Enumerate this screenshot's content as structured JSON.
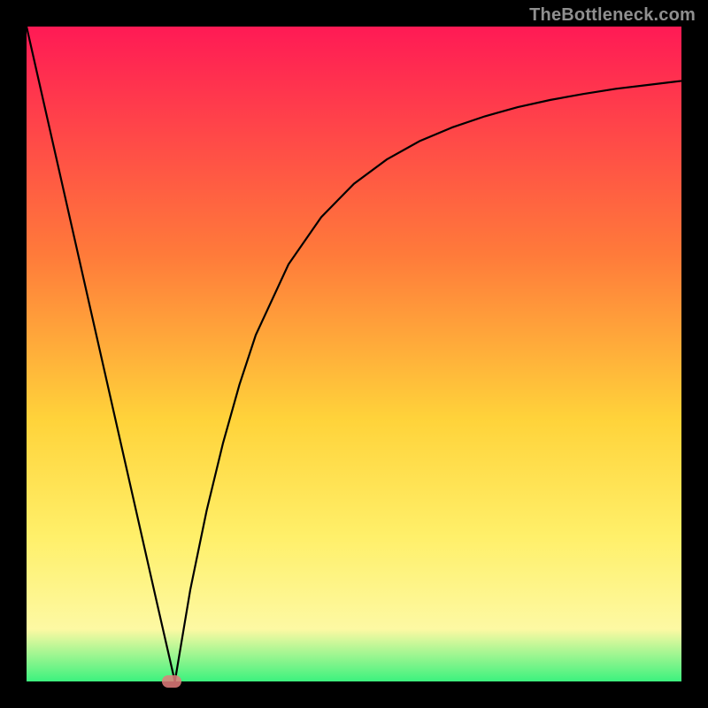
{
  "watermark": "TheBottleneck.com",
  "gradient": {
    "top": "#ff1a55",
    "mid1": "#ff7b3a",
    "mid2": "#ffd33a",
    "mid3": "#fff06a",
    "mid4": "#fdf9a3",
    "bottom": "#3cf27e"
  },
  "chart_data": {
    "type": "line",
    "title": "",
    "xlabel": "",
    "ylabel": "",
    "xlim": [
      0,
      100
    ],
    "ylim": [
      0,
      100
    ],
    "series": [
      {
        "name": "bottleneck-curve",
        "x": [
          0,
          5,
          10,
          15,
          20,
          22.65,
          25,
          27.5,
          30,
          32.5,
          35,
          40,
          45,
          50,
          55,
          60,
          65,
          70,
          75,
          80,
          85,
          90,
          95,
          100
        ],
        "y": [
          100,
          77.9,
          55.8,
          33.7,
          11.6,
          0,
          14.0,
          26.1,
          36.4,
          45.3,
          52.9,
          63.7,
          70.9,
          76.0,
          79.7,
          82.5,
          84.6,
          86.3,
          87.7,
          88.8,
          89.7,
          90.5,
          91.1,
          91.7
        ]
      }
    ],
    "marker": {
      "x": 22.1,
      "y": 0,
      "color": "#e27d7b"
    },
    "background_gradient_stops": [
      {
        "offset": 0.0,
        "color": "#ff1a55"
      },
      {
        "offset": 0.35,
        "color": "#ff7b3a"
      },
      {
        "offset": 0.6,
        "color": "#ffd33a"
      },
      {
        "offset": 0.78,
        "color": "#fff06a"
      },
      {
        "offset": 0.92,
        "color": "#fdf9a3"
      },
      {
        "offset": 1.0,
        "color": "#3cf27e"
      }
    ]
  }
}
